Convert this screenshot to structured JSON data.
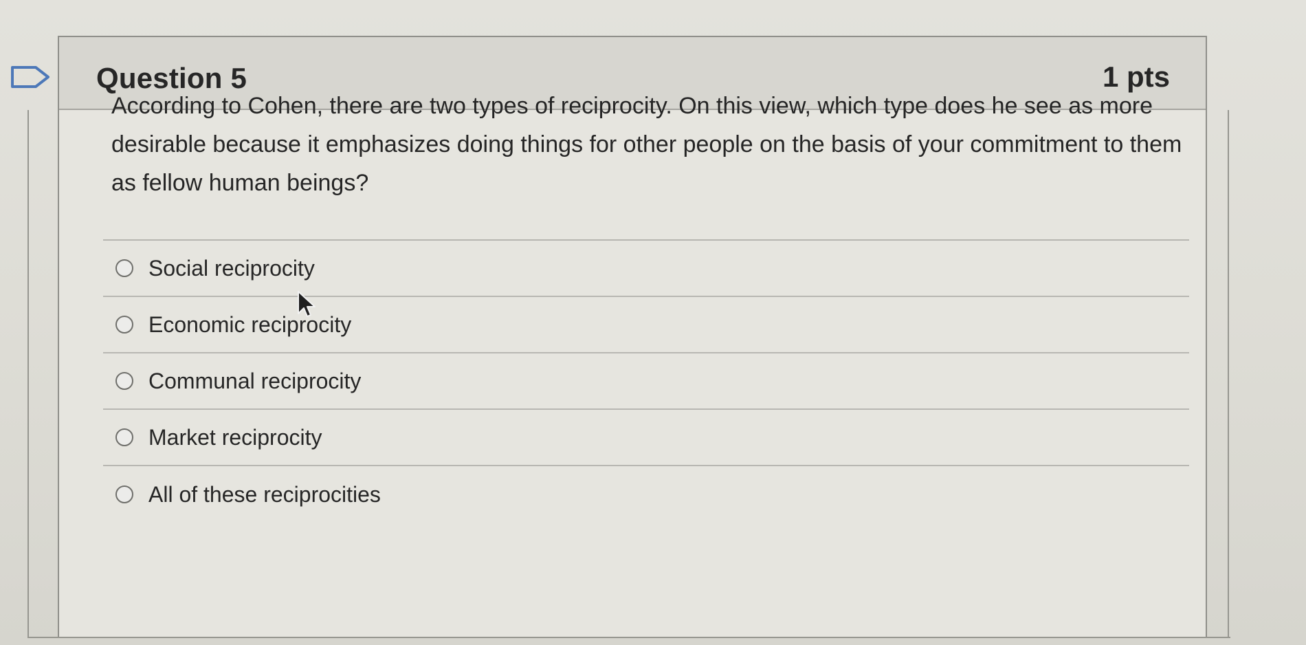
{
  "question": {
    "title": "Question 5",
    "points": "1 pts",
    "text": "According to Cohen, there are two types of reciprocity.  On this view, which type does he see as more desirable because it emphasizes doing things for other people on the basis of your commitment to them as fellow human beings?"
  },
  "answers": [
    {
      "label": "Social reciprocity"
    },
    {
      "label": "Economic reciprocity"
    },
    {
      "label": "Communal reciprocity"
    },
    {
      "label": "Market reciprocity"
    },
    {
      "label": "All of these reciprocities"
    }
  ],
  "icons": {
    "flag": "flag-icon",
    "cursor": "cursor-icon",
    "radio": "radio-button-icon"
  },
  "colors": {
    "page_background": "#e0dfd9",
    "header_background": "#d7d6d0",
    "text": "#262626",
    "border": "#8f8f8a"
  }
}
